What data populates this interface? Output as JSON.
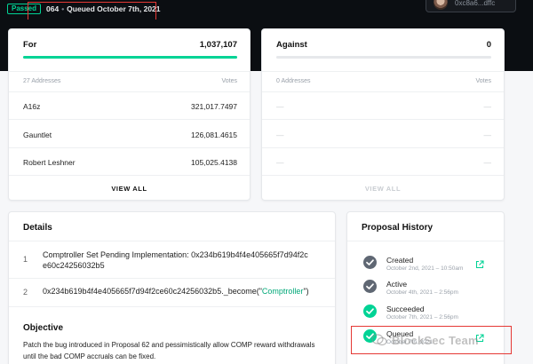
{
  "header": {
    "status_badge": "Passed",
    "proposal_id": "064",
    "separator": "•",
    "status_text": "Queued October 7th, 2021",
    "account_address": "0xc8a6...dffc"
  },
  "votes": {
    "for": {
      "title": "For",
      "total": "1,037,107",
      "bar_fraction": 1.0,
      "addresses_label": "27 Addresses",
      "votes_label": "Votes",
      "rows": [
        {
          "name": "A16z",
          "votes": "321,017.7497"
        },
        {
          "name": "Gauntlet",
          "votes": "126,081.4615"
        },
        {
          "name": "Robert Leshner",
          "votes": "105,025.4138"
        }
      ],
      "view_all": "VIEW ALL"
    },
    "against": {
      "title": "Against",
      "total": "0",
      "bar_fraction": 0.0,
      "addresses_label": "0 Addresses",
      "votes_label": "Votes",
      "rows": [
        {
          "name": "—",
          "votes": "—"
        },
        {
          "name": "—",
          "votes": "—"
        },
        {
          "name": "—",
          "votes": "—"
        }
      ],
      "view_all": "VIEW ALL"
    }
  },
  "details": {
    "title": "Details",
    "actions": [
      {
        "index": "1",
        "line1": "Comptroller Set Pending Implementation: 0x234b619b4f4e405665f7d94f2c",
        "line2": "e60c24256032b5"
      },
      {
        "index": "2",
        "prefix": "0x234b619b4f4e405665f7d94f2ce60c24256032b5._become(\"",
        "link": "Comptroller",
        "suffix": "\")"
      }
    ],
    "objective_title": "Objective",
    "objective_text": "Patch the bug introduced in Proposal 62 and pessimistically allow COMP reward withdrawals until the bad COMP accruals can be fixed."
  },
  "history": {
    "title": "Proposal History",
    "items": [
      {
        "label": "Created",
        "date": "October 2nd, 2021 – 10:50am",
        "state": "gray"
      },
      {
        "label": "Active",
        "date": "October 4th, 2021 – 2:56pm",
        "state": "gray"
      },
      {
        "label": "Succeeded",
        "date": "October 7th, 2021 – 2:56pm",
        "state": "green"
      },
      {
        "label": "Queued",
        "date": "October 7th, 2021",
        "state": "green"
      }
    ]
  },
  "watermark": {
    "text": "BlockSec Team"
  },
  "colors": {
    "accent_green": "#00d395",
    "gray_icon": "#5f6773",
    "annotation_red": "#e53935",
    "header_bg": "#0b0e12"
  }
}
